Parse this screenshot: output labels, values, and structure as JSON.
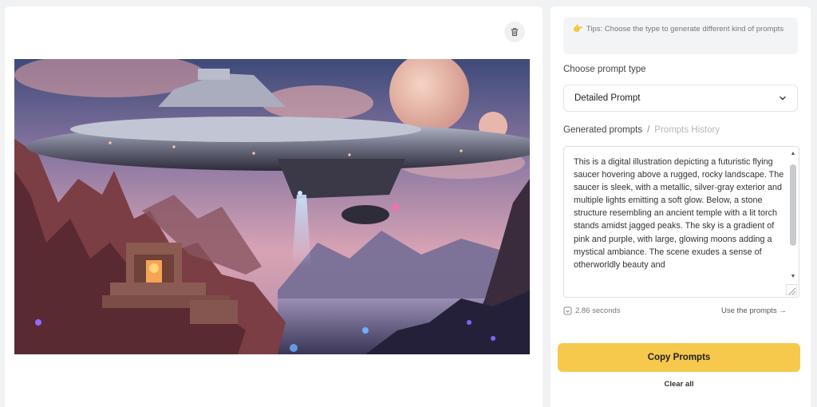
{
  "tips": {
    "icon": "pointing-hand-icon",
    "text": "Tips: Choose the type to generate different kind of prompts"
  },
  "prompt_type": {
    "label": "Choose prompt type",
    "selected": "Detailed Prompt"
  },
  "tabs": {
    "generated": "Generated prompts",
    "separator": "/",
    "history": "Prompts History"
  },
  "generated_text": "This is a digital illustration depicting a futuristic flying saucer hovering above a rugged, rocky landscape. The saucer is sleek, with a metallic, silver-gray exterior and multiple lights emitting a soft glow. Below, a stone structure resembling an ancient temple with a lit torch stands amidst jagged peaks. The sky is a gradient of pink and purple, with large, glowing moons adding a mystical ambiance. The scene exudes a sense of otherworldly beauty and",
  "generation_time": "2.86 seconds",
  "use_prompts_label": "Use the prompts →",
  "copy_button": "Copy Prompts",
  "clear_button": "Clear all",
  "colors": {
    "accent": "#f6c84c",
    "panel": "#ffffff",
    "background": "#f1f2f4"
  }
}
